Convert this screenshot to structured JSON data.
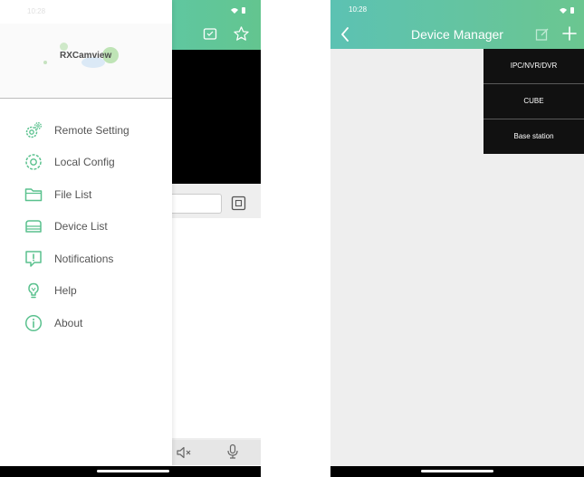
{
  "left_screen": {
    "status_time": "10:28",
    "logo": {
      "text": "RXCamview"
    },
    "drawer_menu": [
      {
        "label": "Remote Setting",
        "icon": "gear-pair-icon"
      },
      {
        "label": "Local Config",
        "icon": "gear-icon"
      },
      {
        "label": "File List",
        "icon": "folder-icon"
      },
      {
        "label": "Device List",
        "icon": "device-icon"
      },
      {
        "label": "Notifications",
        "icon": "alert-icon"
      },
      {
        "label": "Help",
        "icon": "help-icon"
      },
      {
        "label": "About",
        "icon": "info-icon"
      }
    ]
  },
  "right_screen": {
    "status_time": "10:28",
    "title": "Device Manager",
    "dropdown_options": [
      "IPC/NVR/DVR",
      "CUBE",
      "Base station"
    ]
  },
  "colors": {
    "accent_green": "#5ac18e",
    "header_start": "#5cc2b3",
    "header_end": "#6bc690",
    "menu_text": "#555555",
    "dropdown_bg": "#111111"
  }
}
